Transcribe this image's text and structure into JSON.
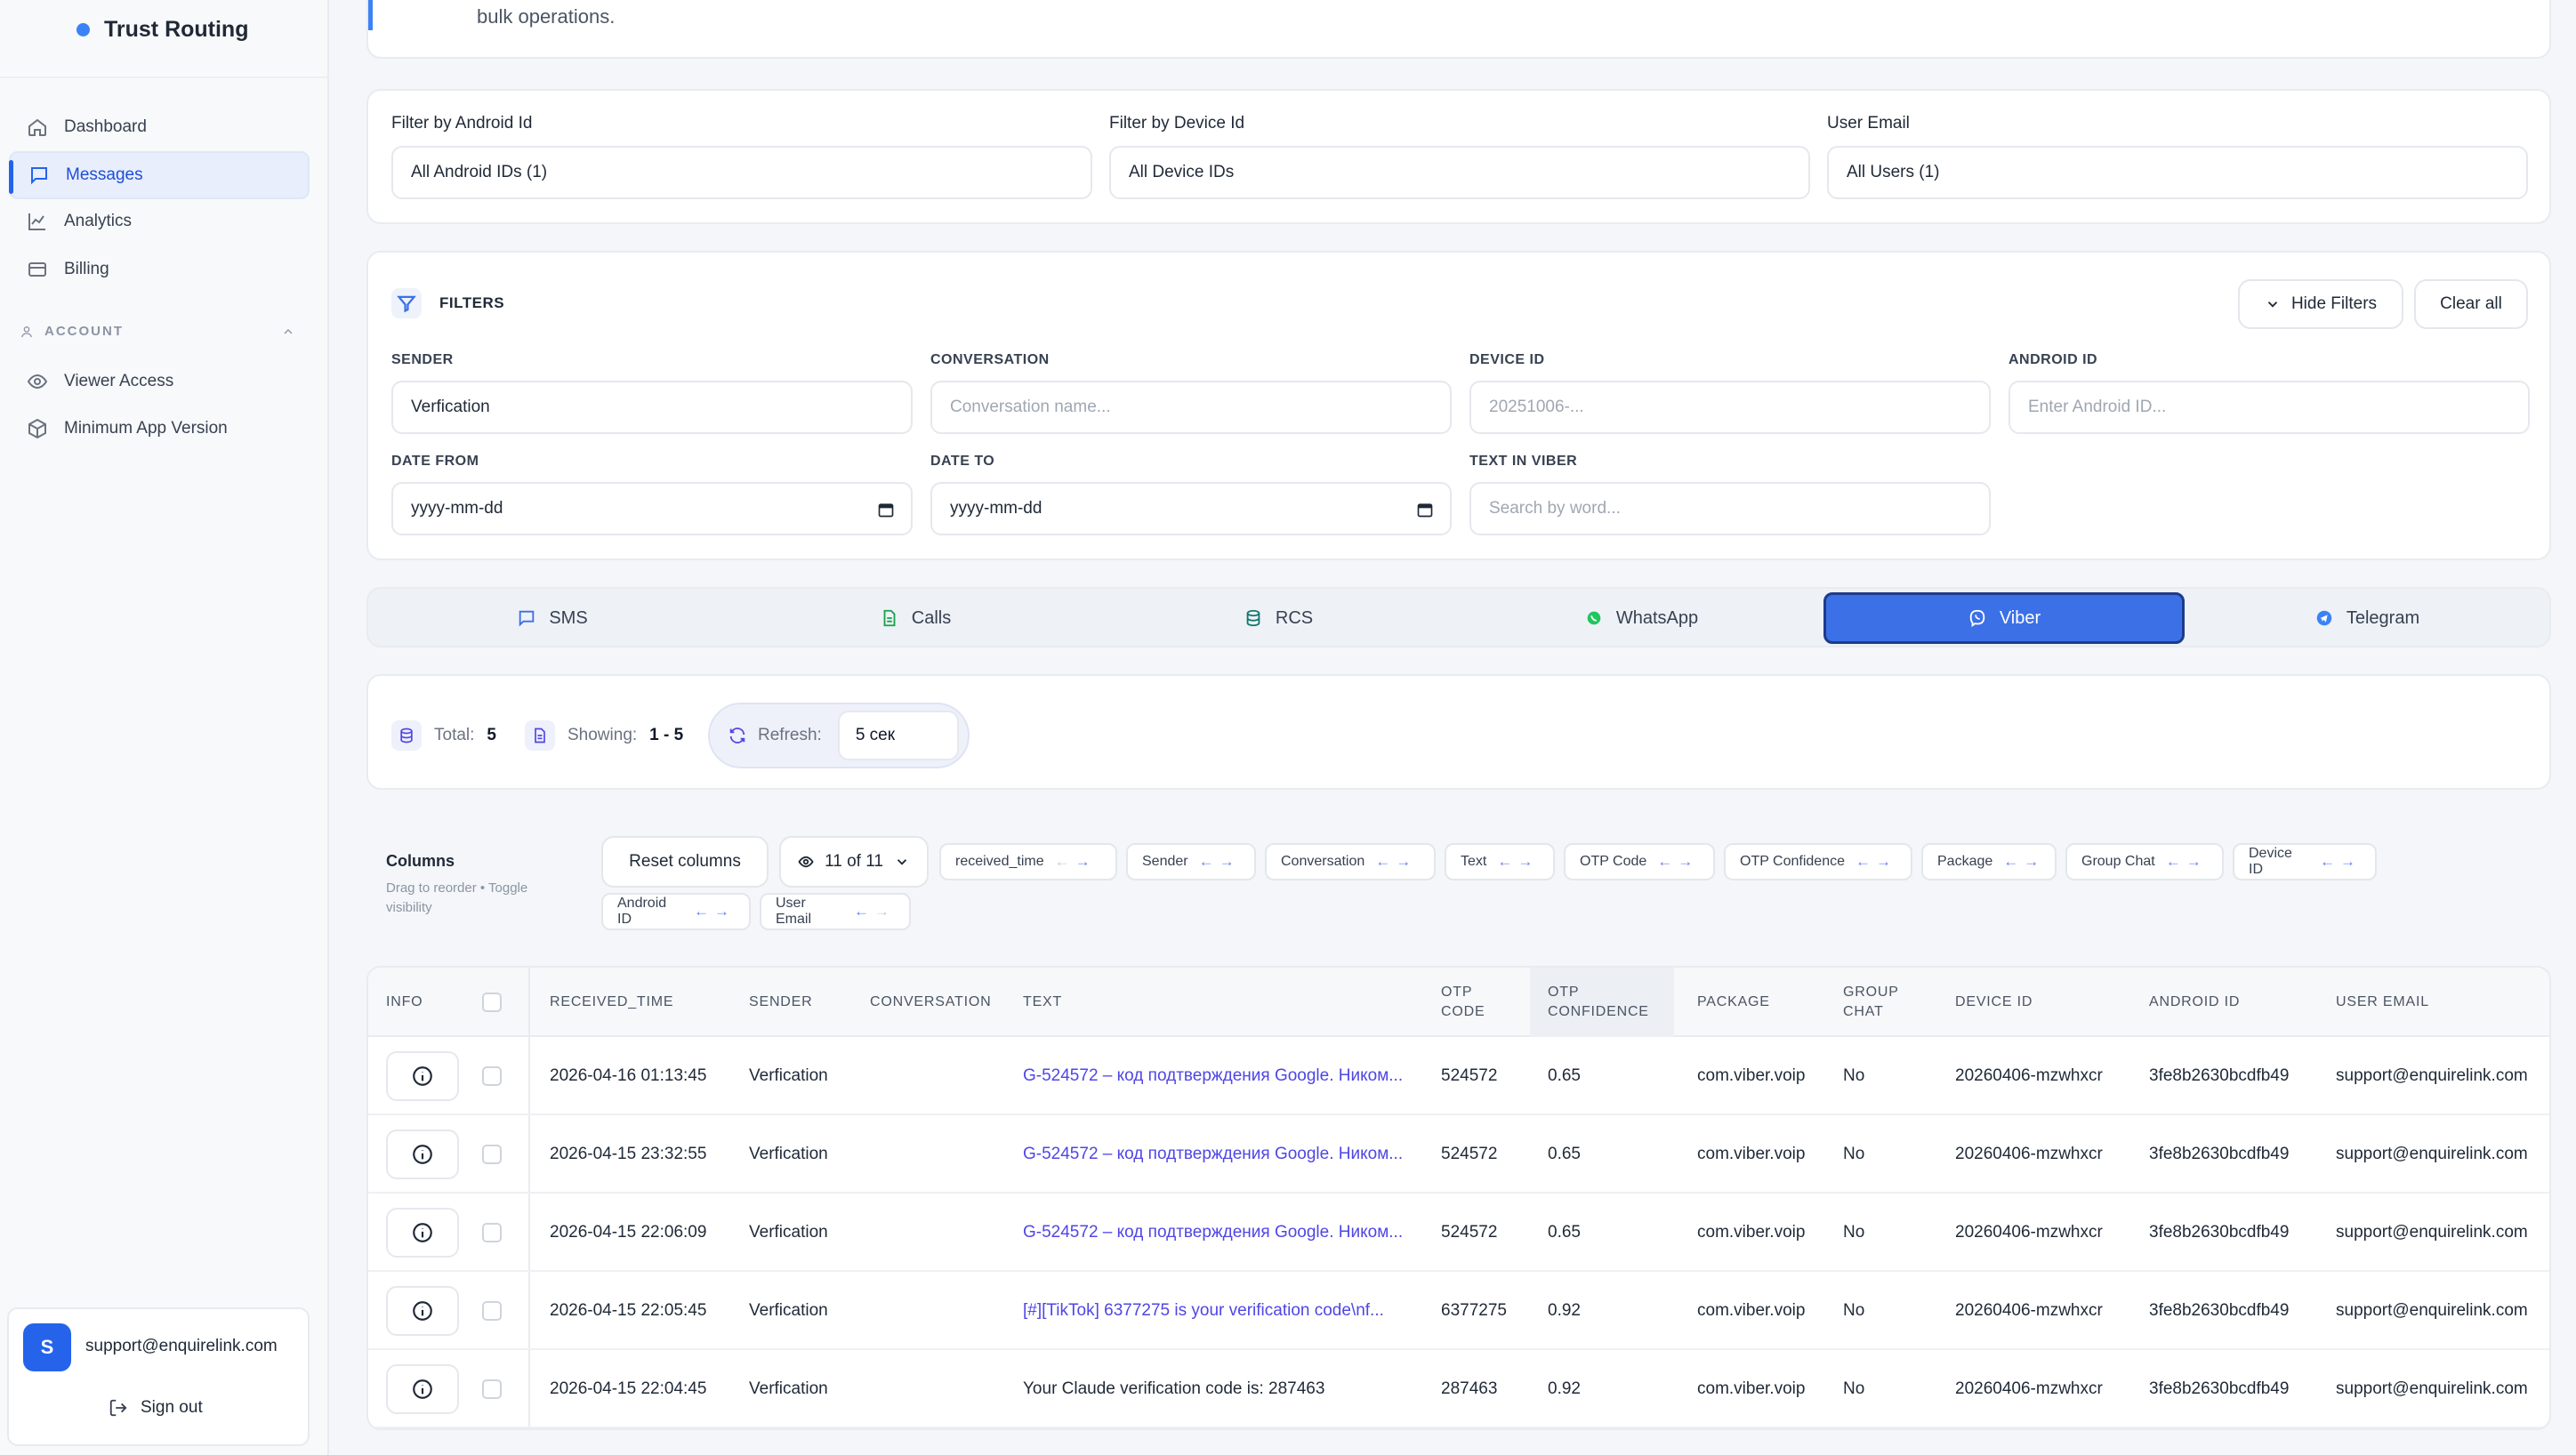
{
  "brand": {
    "name": "Trust Routing",
    "color": "#3b82f6"
  },
  "sidebar": {
    "items": [
      {
        "label": "Dashboard",
        "icon": "home-icon"
      },
      {
        "label": "Messages",
        "icon": "message-icon",
        "active": true
      },
      {
        "label": "Analytics",
        "icon": "chart-icon"
      },
      {
        "label": "Billing",
        "icon": "card-icon"
      }
    ],
    "section": "ACCOUNT",
    "account_items": [
      {
        "label": "Viewer Access",
        "icon": "eye-icon"
      },
      {
        "label": "Minimum App Version",
        "icon": "package-icon"
      }
    ],
    "user": {
      "initial": "S",
      "email": "support@enquirelink.com",
      "signout": "Sign out"
    }
  },
  "banner": {
    "text": "bulk operations."
  },
  "top_filters": [
    {
      "label": "Filter by Android Id",
      "value": "All Android IDs (1)"
    },
    {
      "label": "Filter by Device Id",
      "value": "All Device IDs"
    },
    {
      "label": "User Email",
      "value": "All Users (1)"
    }
  ],
  "filters": {
    "title": "FILTERS",
    "hide_label": "Hide Filters",
    "clear_label": "Clear all",
    "sender": {
      "label": "SENDER",
      "value": "Verfication"
    },
    "conversation": {
      "label": "CONVERSATION",
      "placeholder": "Conversation name..."
    },
    "device_id": {
      "label": "DEVICE ID",
      "placeholder": "20251006-..."
    },
    "android_id": {
      "label": "ANDROID ID",
      "placeholder": "Enter Android ID..."
    },
    "date_from": {
      "label": "DATE FROM",
      "value": "yyyy-mm-dd"
    },
    "date_to": {
      "label": "DATE TO",
      "value": "yyyy-mm-dd"
    },
    "text_in": {
      "label": "TEXT IN VIBER",
      "placeholder": "Search by word..."
    }
  },
  "tabs": [
    {
      "label": "SMS",
      "icon": "sms-icon"
    },
    {
      "label": "Calls",
      "icon": "calls-icon"
    },
    {
      "label": "RCS",
      "icon": "rcs-icon"
    },
    {
      "label": "WhatsApp",
      "icon": "whatsapp-icon"
    },
    {
      "label": "Viber",
      "icon": "viber-icon",
      "active": true
    },
    {
      "label": "Telegram",
      "icon": "telegram-icon"
    }
  ],
  "stats": {
    "total_label": "Total:",
    "total": "5",
    "showing_label": "Showing:",
    "showing": "1 - 5",
    "refresh_label": "Refresh:",
    "refresh_value": "5 сек"
  },
  "columns": {
    "title": "Columns",
    "hint": "Drag to reorder • Toggle visibility",
    "reset": "Reset columns",
    "visible": "11 of 11",
    "chips": [
      "received_time",
      "Sender",
      "Conversation",
      "Text",
      "OTP Code",
      "OTP Confidence",
      "Package",
      "Group Chat",
      "Device ID",
      "Android ID",
      "User Email"
    ]
  },
  "table": {
    "headers": {
      "info": "INFO",
      "received_time": "RECEIVED_TIME",
      "sender": "SENDER",
      "conversation": "CONVERSATION",
      "text": "TEXT",
      "otp_code_1": "OTP",
      "otp_code_2": "CODE",
      "otp_conf_1": "OTP",
      "otp_conf_2": "CONFIDENCE",
      "package": "PACKAGE",
      "group_1": "GROUP",
      "group_2": "CHAT",
      "device_id": "DEVICE ID",
      "android_id": "ANDROID ID",
      "user_email": "USER EMAIL"
    },
    "rows": [
      {
        "time": "2026-04-16 01:13:45",
        "sender": "Verfication",
        "conversation": "",
        "text": "G-524572 – код подтверждения Google. Ником...",
        "link": true,
        "otp": "524572",
        "conf": "0.65",
        "package": "com.viber.voip",
        "group": "No",
        "device": "20260406-mzwhxcr",
        "android": "3fe8b2630bcdfb49",
        "email": "support@enquirelink.com"
      },
      {
        "time": "2026-04-15 23:32:55",
        "sender": "Verfication",
        "conversation": "",
        "text": "G-524572 – код подтверждения Google. Ником...",
        "link": true,
        "otp": "524572",
        "conf": "0.65",
        "package": "com.viber.voip",
        "group": "No",
        "device": "20260406-mzwhxcr",
        "android": "3fe8b2630bcdfb49",
        "email": "support@enquirelink.com"
      },
      {
        "time": "2026-04-15 22:06:09",
        "sender": "Verfication",
        "conversation": "",
        "text": "G-524572 – код подтверждения Google. Ником...",
        "link": true,
        "otp": "524572",
        "conf": "0.65",
        "package": "com.viber.voip",
        "group": "No",
        "device": "20260406-mzwhxcr",
        "android": "3fe8b2630bcdfb49",
        "email": "support@enquirelink.com"
      },
      {
        "time": "2026-04-15 22:05:45",
        "sender": "Verfication",
        "conversation": "",
        "text": "[#][TikTok] 6377275 is your verification code\\nf...",
        "link": true,
        "otp": "6377275",
        "conf": "0.92",
        "package": "com.viber.voip",
        "group": "No",
        "device": "20260406-mzwhxcr",
        "android": "3fe8b2630bcdfb49",
        "email": "support@enquirelink.com"
      },
      {
        "time": "2026-04-15 22:04:45",
        "sender": "Verfication",
        "conversation": "",
        "text": "Your Claude verification code is: 287463",
        "link": false,
        "otp": "287463",
        "conf": "0.92",
        "package": "com.viber.voip",
        "group": "No",
        "device": "20260406-mzwhxcr",
        "android": "3fe8b2630bcdfb49",
        "email": "support@enquirelink.com"
      }
    ]
  },
  "colors": {
    "accent": "#3b70e6",
    "link": "#4f46e5",
    "whatsapp": "#22c55e",
    "telegram": "#3b82f6"
  }
}
